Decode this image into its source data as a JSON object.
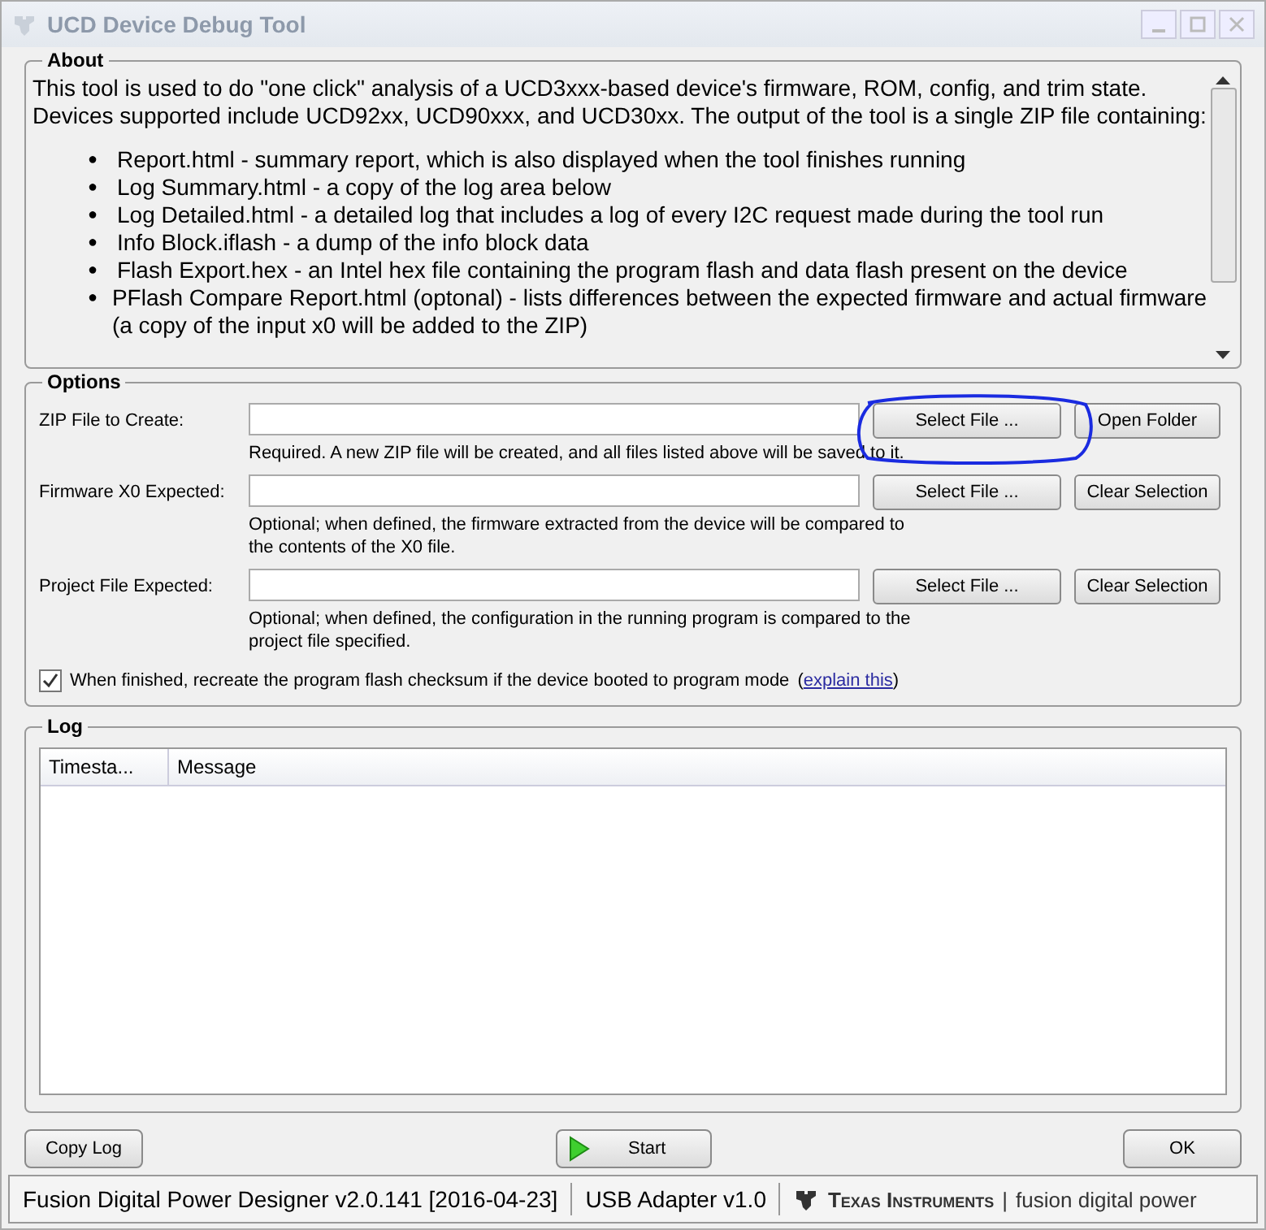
{
  "window": {
    "title": "UCD Device Debug Tool"
  },
  "about": {
    "title": "About",
    "bullet": "●",
    "intro": "This tool is used to do \"one click\" analysis of a UCD3xxx-based device's firmware, ROM, config, and trim state. Devices supported include UCD92xx, UCD90xxx, and UCD30xx. The output of the tool is a single ZIP file containing:",
    "items": [
      "Report.html - summary report, which is also displayed when the tool finishes running",
      "Log Summary.html - a copy of the log area below",
      "Log Detailed.html - a detailed log that includes a log of every I2C request made during the tool run",
      "Info Block.iflash - a dump of the info block data",
      "Flash Export.hex - an Intel hex file containing the program flash and data flash present on the device",
      "PFlash Compare Report.html (optonal) - lists differences between the expected firmware and actual firmware (a copy of the input x0 will be added to the ZIP)"
    ]
  },
  "options": {
    "title": "Options",
    "fields": [
      {
        "label": "ZIP File to Create:",
        "hint": "Required. A new ZIP file will be created, and all files listed above will be saved to it.",
        "buttons": [
          "Select File ...",
          "Open Folder"
        ],
        "circled": true
      },
      {
        "label": "Firmware X0 Expected:",
        "hint": "Optional; when defined, the firmware extracted from the device will be compared to the contents of the X0 file.",
        "buttons": [
          "Select File ...",
          "Clear Selection"
        ],
        "circled": false
      },
      {
        "label": "Project File Expected:",
        "hint": "Optional; when defined, the configuration in the running program is compared to the project file specified.",
        "buttons": [
          "Select File ...",
          "Clear Selection"
        ],
        "circled": false
      }
    ],
    "checkbox": {
      "label": "When finished, recreate the program flash checksum if the device booted to program mode",
      "checked": true,
      "paren_open": "(",
      "link": "explain this",
      "paren_close": ")"
    }
  },
  "log": {
    "title": "Log",
    "columns": [
      "Timesta...",
      "Message"
    ]
  },
  "buttons": {
    "copy": "Copy Log",
    "start": "Start",
    "ok": "OK"
  },
  "status_bar": {
    "app": "Fusion Digital Power Designer v2.0.141 [2016-04-23]",
    "adapter": "USB Adapter v1.0",
    "brand": "Texas Instruments",
    "separator": "|",
    "tagline": "fusion digital power"
  }
}
